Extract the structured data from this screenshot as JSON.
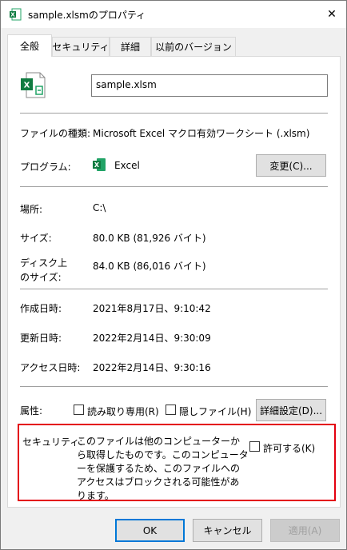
{
  "window": {
    "title": "sample.xlsmのプロパティ",
    "title_icon": "excel-file-icon",
    "close_label": "✕"
  },
  "tabs": [
    {
      "label": "全般",
      "active": true
    },
    {
      "label": "セキュリティ",
      "active": false
    },
    {
      "label": "詳細",
      "active": false
    },
    {
      "label": "以前のバージョン",
      "active": false
    }
  ],
  "general": {
    "file_name": "sample.xlsm",
    "file_type_label": "ファイルの種類:",
    "file_type_value": "Microsoft Excel マクロ有効ワークシート (.xlsm)",
    "program_label": "プログラム:",
    "program_value": "Excel",
    "change_button": "変更(C)...",
    "location_label": "場所:",
    "location_value": "C:\\",
    "size_label": "サイズ:",
    "size_value": "80.0 KB (81,926 バイト)",
    "disk_size_label_line1": "ディスク上",
    "disk_size_label_line2": "のサイズ:",
    "disk_size_value": "84.0 KB (86,016 バイト)",
    "created_label": "作成日時:",
    "created_value": "2021年8月17日、9:10:42",
    "modified_label": "更新日時:",
    "modified_value": "2022年2月14日、9:30:09",
    "accessed_label": "アクセス日時:",
    "accessed_value": "2022年2月14日、9:30:16",
    "attributes_label": "属性:",
    "readonly_label": "読み取り専用(R)",
    "hidden_label": "隠しファイル(H)",
    "advanced_button": "詳細設定(D)...",
    "security_label": "セキュリティ:",
    "security_text": "このファイルは他のコンピューターから取得したものです。このコンピューターを保護するため、このファイルへのアクセスはブロックされる可能性があります。",
    "unblock_label": "許可する(K)"
  },
  "footer": {
    "ok": "OK",
    "cancel": "キャンセル",
    "apply": "適用(A)"
  },
  "colors": {
    "highlight_border": "#e3000f",
    "excel_green": "#107c41",
    "default_button_border": "#0078d7"
  }
}
